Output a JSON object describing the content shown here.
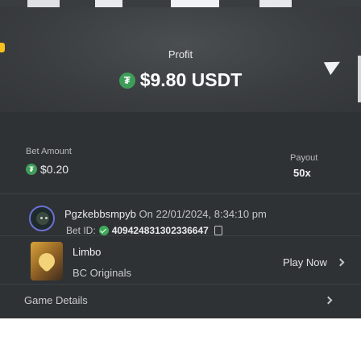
{
  "hero": {
    "profit_label": "Profit",
    "profit_amount": "$9.80",
    "profit_currency": "USDT",
    "currency_icon": "usdt-coin-icon"
  },
  "bet": {
    "amount_label": "Bet Amount",
    "amount_value": "$0.20",
    "payout_label": "Payout",
    "payout_value": "50x"
  },
  "user": {
    "name": "Pgzkebbsmpyb",
    "on_text": "On 22/01/2024, 8:34:10 pm",
    "bet_id_label": "Bet ID:",
    "bet_id": "409424831302336647",
    "verified_icon": "verified-check-icon"
  },
  "game": {
    "name": "Limbo",
    "provider": "BC Originals",
    "play_label": "Play Now"
  },
  "details": {
    "label": "Game Details"
  },
  "colors": {
    "panel_bg": "#2f3235",
    "usdt_green": "#3f9d5a",
    "accent_yellow": "#f4c21a",
    "avatar_ring": "#6c71d3"
  }
}
